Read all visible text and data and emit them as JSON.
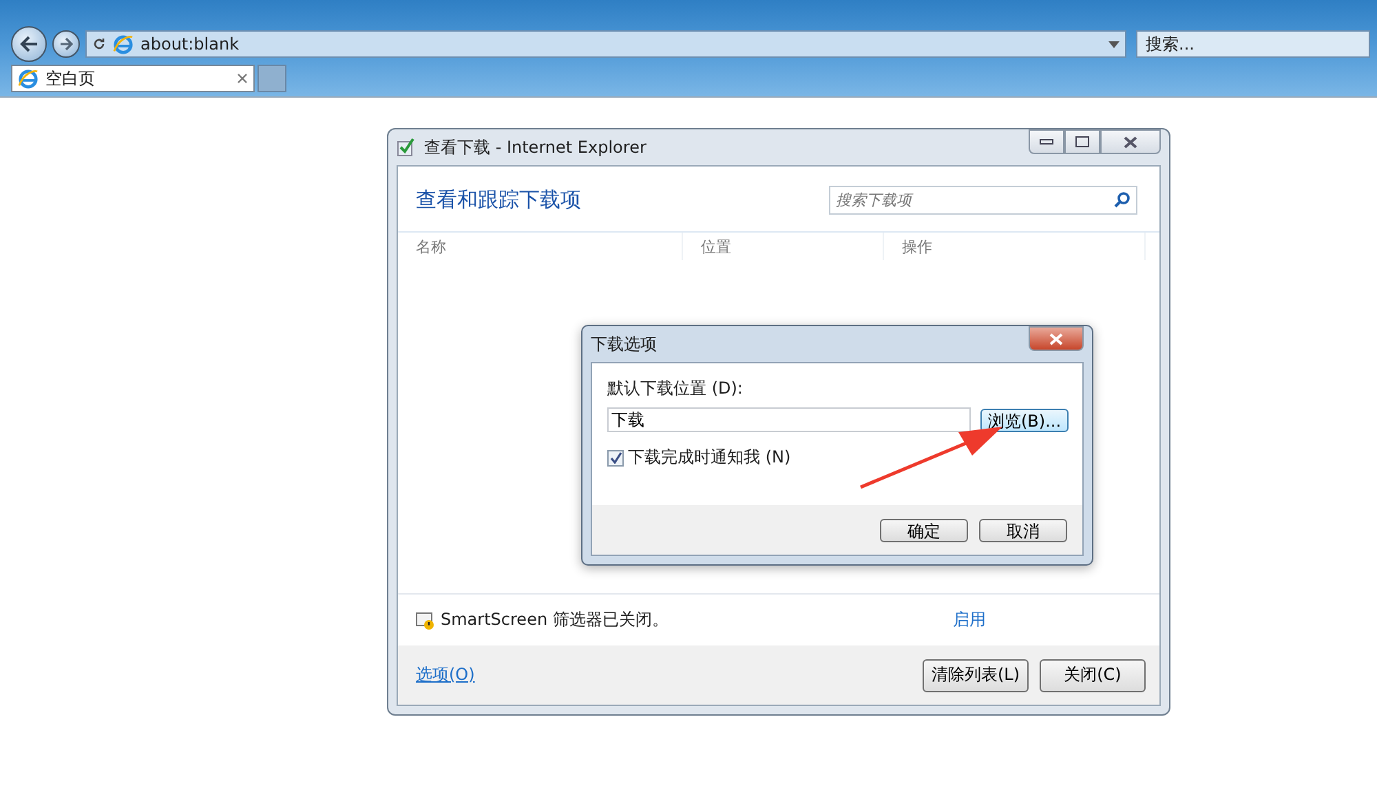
{
  "browser": {
    "address": "about:blank",
    "search": {
      "placeholder": "搜索..."
    },
    "tabs": [
      {
        "label": "空白页",
        "selected": true
      }
    ]
  },
  "downloads_window": {
    "title": "查看下载 - Internet Explorer",
    "heading": "查看和跟踪下载项",
    "search": {
      "placeholder": "搜索下载项"
    },
    "columns": [
      "名称",
      "位置",
      "操作"
    ],
    "smartscreen": {
      "message": "SmartScreen 筛选器已关闭。",
      "action": "启用"
    },
    "options_link": "选项(O)",
    "buttons": [
      "清除列表(L)",
      "关闭(C)"
    ]
  },
  "dialog": {
    "title": "下载选项",
    "location_label": "默认下载位置 (D):",
    "location_value": "下载",
    "browse_button": "浏览(B)...",
    "notify": {
      "label": "下载完成时通知我 (N)",
      "checked": true
    },
    "buttons": [
      "确定",
      "取消"
    ]
  }
}
